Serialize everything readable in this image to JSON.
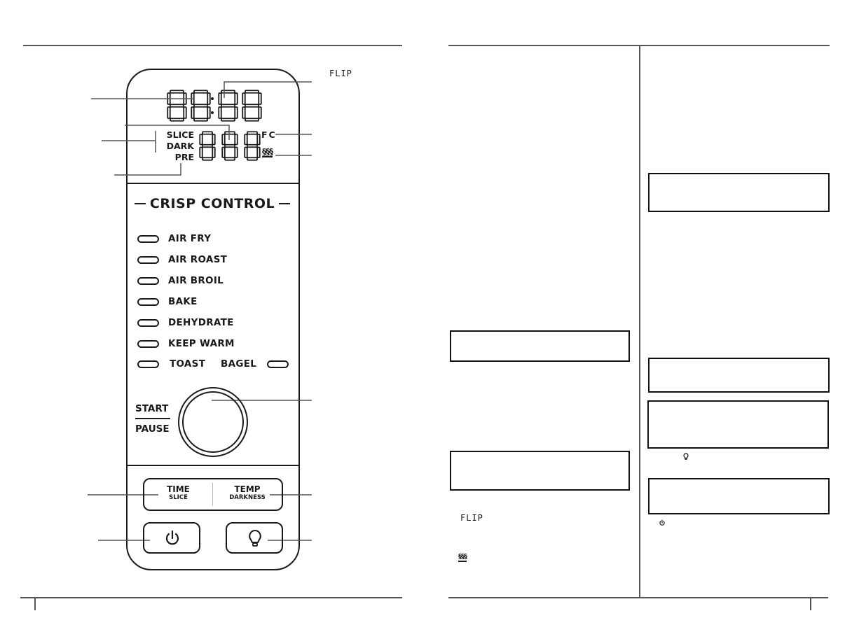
{
  "left_page": {
    "lcd": {
      "time_digits": "88:88",
      "temp_digits": "888",
      "labels": [
        "SLICE",
        "DARK",
        "PRE"
      ],
      "units": "FC",
      "flip_indicator": "FLIP",
      "heat_icon": "heating-icon"
    },
    "crisp_control_title": "CRISP CONTROL",
    "functions": [
      {
        "label": "AIR FRY"
      },
      {
        "label": "AIR ROAST"
      },
      {
        "label": "AIR BROIL"
      },
      {
        "label": "BAKE"
      },
      {
        "label": "DEHYDRATE"
      },
      {
        "label": "KEEP WARM"
      },
      {
        "label": "TOAST"
      }
    ],
    "bagel_label": "BAGEL",
    "start_label": "START",
    "pause_label": "PAUSE",
    "time_button": {
      "main": "TIME",
      "sub": "SLICE"
    },
    "temp_button": {
      "main": "TEMP",
      "sub": "DARKNESS"
    },
    "power_icon": "power-icon",
    "light_icon": "light-bulb-icon"
  },
  "right_page": {
    "flip_label": "FLIP",
    "heat_icon": "heating-icon",
    "light_icon": "light-bulb-icon",
    "power_icon": "power-icon"
  },
  "colors": {
    "ink": "#1a1a1a",
    "rule": "#555555"
  }
}
